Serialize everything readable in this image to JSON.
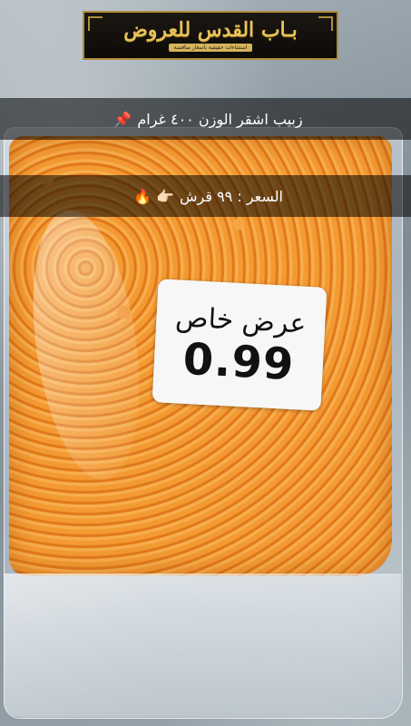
{
  "logo": {
    "name": "بـاب القدس للعروض",
    "tagline": "استثناءات حقيقية بأسعار منافسة"
  },
  "captions": [
    {
      "text": "زبيب اشقر الوزن ٤٠٠ غرام",
      "emoji": "📌"
    },
    {
      "text": "السعر : ٩٩ قرش",
      "emoji": "👉🏻 🔥"
    }
  ],
  "sticker": {
    "offer": "عرض خاص",
    "price": "0.99"
  },
  "colors": {
    "caption_bg": "#000000",
    "raisin": "#e98a2a",
    "logo_gold": "#e8c25a"
  }
}
